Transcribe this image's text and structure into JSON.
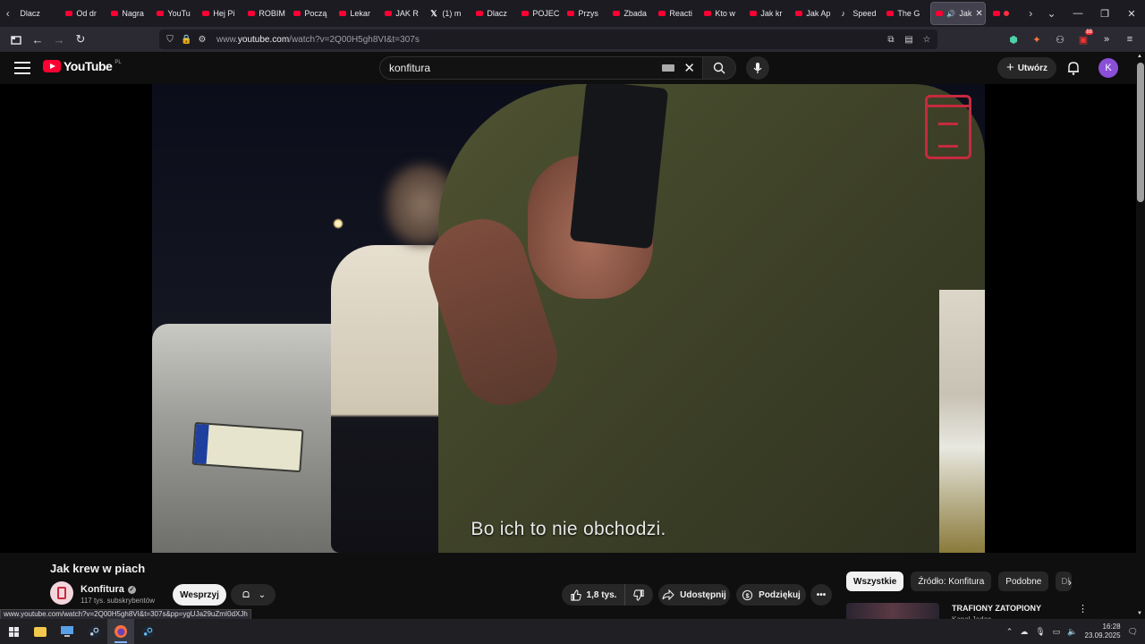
{
  "browser": {
    "tabs": [
      {
        "label": "Dlacz",
        "favicon": "none"
      },
      {
        "label": "Od dr",
        "favicon": "youtube-icon"
      },
      {
        "label": "Nagra",
        "favicon": "youtube-icon"
      },
      {
        "label": "YouTu",
        "favicon": "youtube-icon"
      },
      {
        "label": "Hej Pi",
        "favicon": "youtube-icon"
      },
      {
        "label": "ROBIM",
        "favicon": "youtube-icon"
      },
      {
        "label": "Począ",
        "favicon": "youtube-icon"
      },
      {
        "label": "Lekar",
        "favicon": "youtube-icon"
      },
      {
        "label": "JAK R",
        "favicon": "youtube-icon"
      },
      {
        "label": "(1) m",
        "favicon": "x-icon"
      },
      {
        "label": "Dlacz",
        "favicon": "youtube-icon"
      },
      {
        "label": "POJEC",
        "favicon": "youtube-icon"
      },
      {
        "label": "Przys",
        "favicon": "youtube-icon"
      },
      {
        "label": "Zbada",
        "favicon": "youtube-icon"
      },
      {
        "label": "Reacti",
        "favicon": "youtube-icon"
      },
      {
        "label": "Kto w",
        "favicon": "youtube-icon"
      },
      {
        "label": "Jak kr",
        "favicon": "youtube-icon"
      },
      {
        "label": "Jak Ap",
        "favicon": "youtube-icon"
      },
      {
        "label": "Speed",
        "favicon": "tiktok-icon"
      },
      {
        "label": "The G",
        "favicon": "youtube-icon"
      }
    ],
    "active_tab": {
      "label": "Jak",
      "favicon": "youtube-icon",
      "playing": true
    },
    "url_prefix": "www.",
    "url_domain": "youtube.com",
    "url_path": "/watch?v=2Q00H5gh8VI&t=307s",
    "extension_badge": "88",
    "status_url": "www.youtube.com/watch?v=2Q00H5gh8VI&t=307s&pp=ygUJa29uZmI0dXJh"
  },
  "youtube": {
    "logo_text": "YouTube",
    "country_code": "PL",
    "search_value": "konfitura",
    "create_label": "Utwórz",
    "avatar_letter": "K",
    "accent_color": "#ff0033"
  },
  "video": {
    "subtitle": "Bo ich to nie obchodzi.",
    "title": "Jak krew w piach",
    "channel_name": "Konfitura",
    "subscribers": "117 tys. subskrybentów",
    "support_label": "Wesprzyj",
    "likes": "1,8 tys.",
    "share_label": "Udostępnij",
    "thanks_label": "Podziękuj"
  },
  "sidebar": {
    "chips": [
      "Wszystkie",
      "Źródło: Konfitura",
      "Podobne",
      "Dl"
    ],
    "rec_title": "TRAFIONY ZATOPIONY",
    "rec_channel": "Kanał Jadąc"
  },
  "taskbar": {
    "time": "16:28",
    "date": "23.09.2025"
  }
}
